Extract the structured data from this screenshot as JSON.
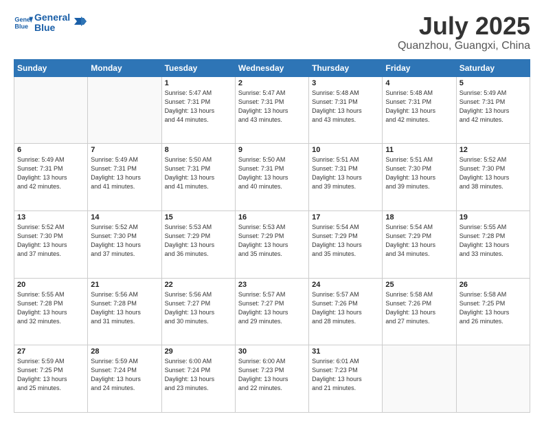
{
  "header": {
    "logo_line1": "General",
    "logo_line2": "Blue",
    "month": "July 2025",
    "location": "Quanzhou, Guangxi, China"
  },
  "weekdays": [
    "Sunday",
    "Monday",
    "Tuesday",
    "Wednesday",
    "Thursday",
    "Friday",
    "Saturday"
  ],
  "weeks": [
    [
      {
        "day": "",
        "info": ""
      },
      {
        "day": "",
        "info": ""
      },
      {
        "day": "1",
        "info": "Sunrise: 5:47 AM\nSunset: 7:31 PM\nDaylight: 13 hours\nand 44 minutes."
      },
      {
        "day": "2",
        "info": "Sunrise: 5:47 AM\nSunset: 7:31 PM\nDaylight: 13 hours\nand 43 minutes."
      },
      {
        "day": "3",
        "info": "Sunrise: 5:48 AM\nSunset: 7:31 PM\nDaylight: 13 hours\nand 43 minutes."
      },
      {
        "day": "4",
        "info": "Sunrise: 5:48 AM\nSunset: 7:31 PM\nDaylight: 13 hours\nand 42 minutes."
      },
      {
        "day": "5",
        "info": "Sunrise: 5:49 AM\nSunset: 7:31 PM\nDaylight: 13 hours\nand 42 minutes."
      }
    ],
    [
      {
        "day": "6",
        "info": "Sunrise: 5:49 AM\nSunset: 7:31 PM\nDaylight: 13 hours\nand 42 minutes."
      },
      {
        "day": "7",
        "info": "Sunrise: 5:49 AM\nSunset: 7:31 PM\nDaylight: 13 hours\nand 41 minutes."
      },
      {
        "day": "8",
        "info": "Sunrise: 5:50 AM\nSunset: 7:31 PM\nDaylight: 13 hours\nand 41 minutes."
      },
      {
        "day": "9",
        "info": "Sunrise: 5:50 AM\nSunset: 7:31 PM\nDaylight: 13 hours\nand 40 minutes."
      },
      {
        "day": "10",
        "info": "Sunrise: 5:51 AM\nSunset: 7:31 PM\nDaylight: 13 hours\nand 39 minutes."
      },
      {
        "day": "11",
        "info": "Sunrise: 5:51 AM\nSunset: 7:30 PM\nDaylight: 13 hours\nand 39 minutes."
      },
      {
        "day": "12",
        "info": "Sunrise: 5:52 AM\nSunset: 7:30 PM\nDaylight: 13 hours\nand 38 minutes."
      }
    ],
    [
      {
        "day": "13",
        "info": "Sunrise: 5:52 AM\nSunset: 7:30 PM\nDaylight: 13 hours\nand 37 minutes."
      },
      {
        "day": "14",
        "info": "Sunrise: 5:52 AM\nSunset: 7:30 PM\nDaylight: 13 hours\nand 37 minutes."
      },
      {
        "day": "15",
        "info": "Sunrise: 5:53 AM\nSunset: 7:29 PM\nDaylight: 13 hours\nand 36 minutes."
      },
      {
        "day": "16",
        "info": "Sunrise: 5:53 AM\nSunset: 7:29 PM\nDaylight: 13 hours\nand 35 minutes."
      },
      {
        "day": "17",
        "info": "Sunrise: 5:54 AM\nSunset: 7:29 PM\nDaylight: 13 hours\nand 35 minutes."
      },
      {
        "day": "18",
        "info": "Sunrise: 5:54 AM\nSunset: 7:29 PM\nDaylight: 13 hours\nand 34 minutes."
      },
      {
        "day": "19",
        "info": "Sunrise: 5:55 AM\nSunset: 7:28 PM\nDaylight: 13 hours\nand 33 minutes."
      }
    ],
    [
      {
        "day": "20",
        "info": "Sunrise: 5:55 AM\nSunset: 7:28 PM\nDaylight: 13 hours\nand 32 minutes."
      },
      {
        "day": "21",
        "info": "Sunrise: 5:56 AM\nSunset: 7:28 PM\nDaylight: 13 hours\nand 31 minutes."
      },
      {
        "day": "22",
        "info": "Sunrise: 5:56 AM\nSunset: 7:27 PM\nDaylight: 13 hours\nand 30 minutes."
      },
      {
        "day": "23",
        "info": "Sunrise: 5:57 AM\nSunset: 7:27 PM\nDaylight: 13 hours\nand 29 minutes."
      },
      {
        "day": "24",
        "info": "Sunrise: 5:57 AM\nSunset: 7:26 PM\nDaylight: 13 hours\nand 28 minutes."
      },
      {
        "day": "25",
        "info": "Sunrise: 5:58 AM\nSunset: 7:26 PM\nDaylight: 13 hours\nand 27 minutes."
      },
      {
        "day": "26",
        "info": "Sunrise: 5:58 AM\nSunset: 7:25 PM\nDaylight: 13 hours\nand 26 minutes."
      }
    ],
    [
      {
        "day": "27",
        "info": "Sunrise: 5:59 AM\nSunset: 7:25 PM\nDaylight: 13 hours\nand 25 minutes."
      },
      {
        "day": "28",
        "info": "Sunrise: 5:59 AM\nSunset: 7:24 PM\nDaylight: 13 hours\nand 24 minutes."
      },
      {
        "day": "29",
        "info": "Sunrise: 6:00 AM\nSunset: 7:24 PM\nDaylight: 13 hours\nand 23 minutes."
      },
      {
        "day": "30",
        "info": "Sunrise: 6:00 AM\nSunset: 7:23 PM\nDaylight: 13 hours\nand 22 minutes."
      },
      {
        "day": "31",
        "info": "Sunrise: 6:01 AM\nSunset: 7:23 PM\nDaylight: 13 hours\nand 21 minutes."
      },
      {
        "day": "",
        "info": ""
      },
      {
        "day": "",
        "info": ""
      }
    ]
  ]
}
